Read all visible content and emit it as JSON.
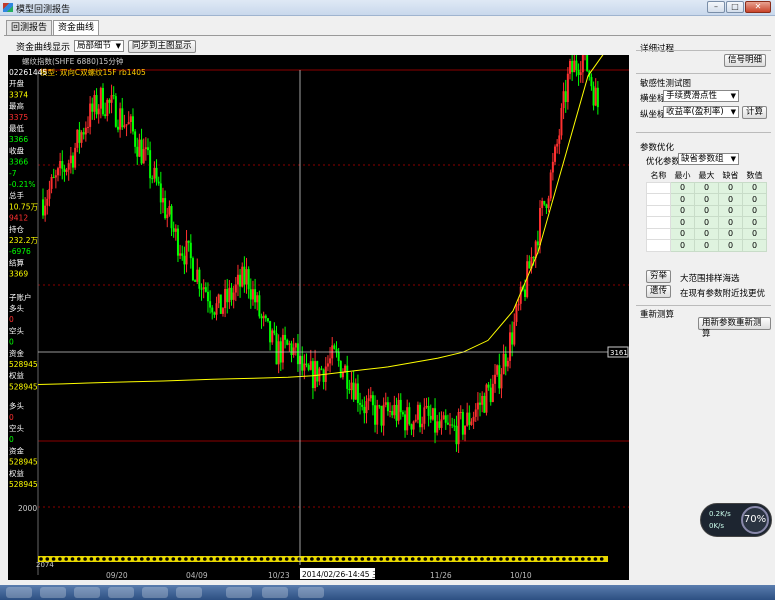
{
  "window": {
    "title": "模型回测报告"
  },
  "tabs": [
    {
      "label": "回测报告"
    },
    {
      "label": "资金曲线"
    }
  ],
  "toolbar": {
    "display_label": "资金曲线显示",
    "select_value": "局部细节",
    "sync_button": "同步到主图显示"
  },
  "chart": {
    "symbol_line": "螺纹指数(SHFE 6880)15分钟",
    "model_line": "模型: 双向C双螺纹15F rb1405",
    "left_panel": [
      {
        "t": "02261445",
        "c": "#ffffff"
      },
      {
        "t": "开盘",
        "c": "#ffffff"
      },
      {
        "t": "3374",
        "c": "#ffff00"
      },
      {
        "t": "最高",
        "c": "#ffffff"
      },
      {
        "t": "3375",
        "c": "#ff3030"
      },
      {
        "t": "最低",
        "c": "#ffffff"
      },
      {
        "t": "3366",
        "c": "#00ff00"
      },
      {
        "t": "收盘",
        "c": "#ffffff"
      },
      {
        "t": "3366",
        "c": "#00ff00"
      },
      {
        "t": "-7",
        "c": "#00ff00"
      },
      {
        "t": "-0.21%",
        "c": "#00ff00"
      },
      {
        "t": "总手",
        "c": "#ffffff"
      },
      {
        "t": "10.75万",
        "c": "#ffff00"
      },
      {
        "t": "9412",
        "c": "#ff3030"
      },
      {
        "t": "持仓",
        "c": "#ffffff"
      },
      {
        "t": "232.2万",
        "c": "#ffff00"
      },
      {
        "t": "-6976",
        "c": "#00ff00"
      },
      {
        "t": "结算",
        "c": "#ffffff"
      },
      {
        "t": "3369",
        "c": "#ffff00"
      },
      {
        "t": "子账户",
        "c": "#ffffff"
      },
      {
        "t": "多头",
        "c": "#ffffff"
      },
      {
        "t": "0",
        "c": "#ff3030"
      },
      {
        "t": "空头",
        "c": "#ffffff"
      },
      {
        "t": "0",
        "c": "#00ff00"
      },
      {
        "t": "资金",
        "c": "#ffffff"
      },
      {
        "t": "528945",
        "c": "#ffff00"
      },
      {
        "t": "权益",
        "c": "#ffffff"
      },
      {
        "t": "528945",
        "c": "#ffff00"
      },
      {
        "t": "多头",
        "c": "#ffffff"
      },
      {
        "t": "0",
        "c": "#ff3030"
      },
      {
        "t": "空头",
        "c": "#ffffff"
      },
      {
        "t": "0",
        "c": "#00ff00"
      },
      {
        "t": "资金",
        "c": "#ffffff"
      },
      {
        "t": "528945",
        "c": "#ffff00"
      },
      {
        "t": "权益",
        "c": "#ffffff"
      },
      {
        "t": "528945",
        "c": "#ffff00"
      }
    ],
    "price_label_2000": "2000",
    "price_label_low": "2074",
    "crosshair_price": "3161",
    "cursor_label": "2014/02/26-14:45 三",
    "x_labels": [
      "09/20",
      "04/09",
      "10/23",
      "11/26",
      "10/10"
    ],
    "colors": {
      "up": "#ff3030",
      "down": "#00ff00",
      "equity": "#ffff00",
      "grid": "#8b0000"
    }
  },
  "chart_data": {
    "type": "line",
    "series": [
      {
        "name": "",
        "values": [
          3080,
          3150,
          3230,
          3350,
          3420,
          3380,
          3320,
          3220,
          3100,
          2960,
          2880,
          2790,
          2700,
          2760,
          2820,
          2660,
          2560,
          2580,
          2470,
          2500,
          2540,
          2480,
          2380,
          2340,
          2360,
          2330,
          2350,
          2300,
          2290,
          2320,
          2390,
          2450,
          2600,
          2780,
          3000,
          3200,
          3500,
          3580,
          3400
        ]
      },
      {
        "name": "",
        "values": [
          2450,
          2452,
          2455,
          2458,
          2460,
          2462,
          2465,
          2468,
          2470,
          2472,
          2475,
          2480,
          2490,
          2500,
          2510,
          2525,
          2540,
          2560,
          2600,
          2700,
          2900,
          3200,
          3500,
          3620
        ]
      }
    ],
    "x_ticks": [
      "09/20",
      "04/09",
      "10/23",
      "11/26",
      "10/10"
    ],
    "y_ticks": [
      2000,
      3161
    ]
  },
  "side": {
    "detail_title": "详细过程",
    "signal_btn": "信号明细",
    "sens_title": "敏感性测试图",
    "xaxis_label": "横坐标",
    "xaxis_value": "手续费滑点性",
    "yaxis_label": "纵坐标",
    "yaxis_value": "收益率(盈利率)",
    "calc_btn": "计算",
    "opt_title": "参数优化",
    "opt_param_label": "优化参数",
    "opt_param_value": "缺省参数组",
    "table_headers": [
      "名称",
      "最小",
      "最大",
      "缺省",
      "数值"
    ],
    "table_rows": [
      [
        "",
        "0",
        "0",
        "0",
        "0"
      ],
      [
        "",
        "0",
        "0",
        "0",
        "0"
      ],
      [
        "",
        "0",
        "0",
        "0",
        "0"
      ],
      [
        "",
        "0",
        "0",
        "0",
        "0"
      ],
      [
        "",
        "0",
        "0",
        "0",
        "0"
      ],
      [
        "",
        "0",
        "0",
        "0",
        "0"
      ]
    ],
    "exhaustive_btn": "穷举",
    "exhaustive_desc": "大范围排样海选",
    "genetic_btn": "遗传",
    "genetic_desc": "在现有参数附近找更优",
    "recalc_title": "重新测算",
    "recalc_btn": "用新参数重新测算"
  },
  "gauge": {
    "up": "0.2K/s",
    "down": "0K/s",
    "percent": "70%"
  }
}
